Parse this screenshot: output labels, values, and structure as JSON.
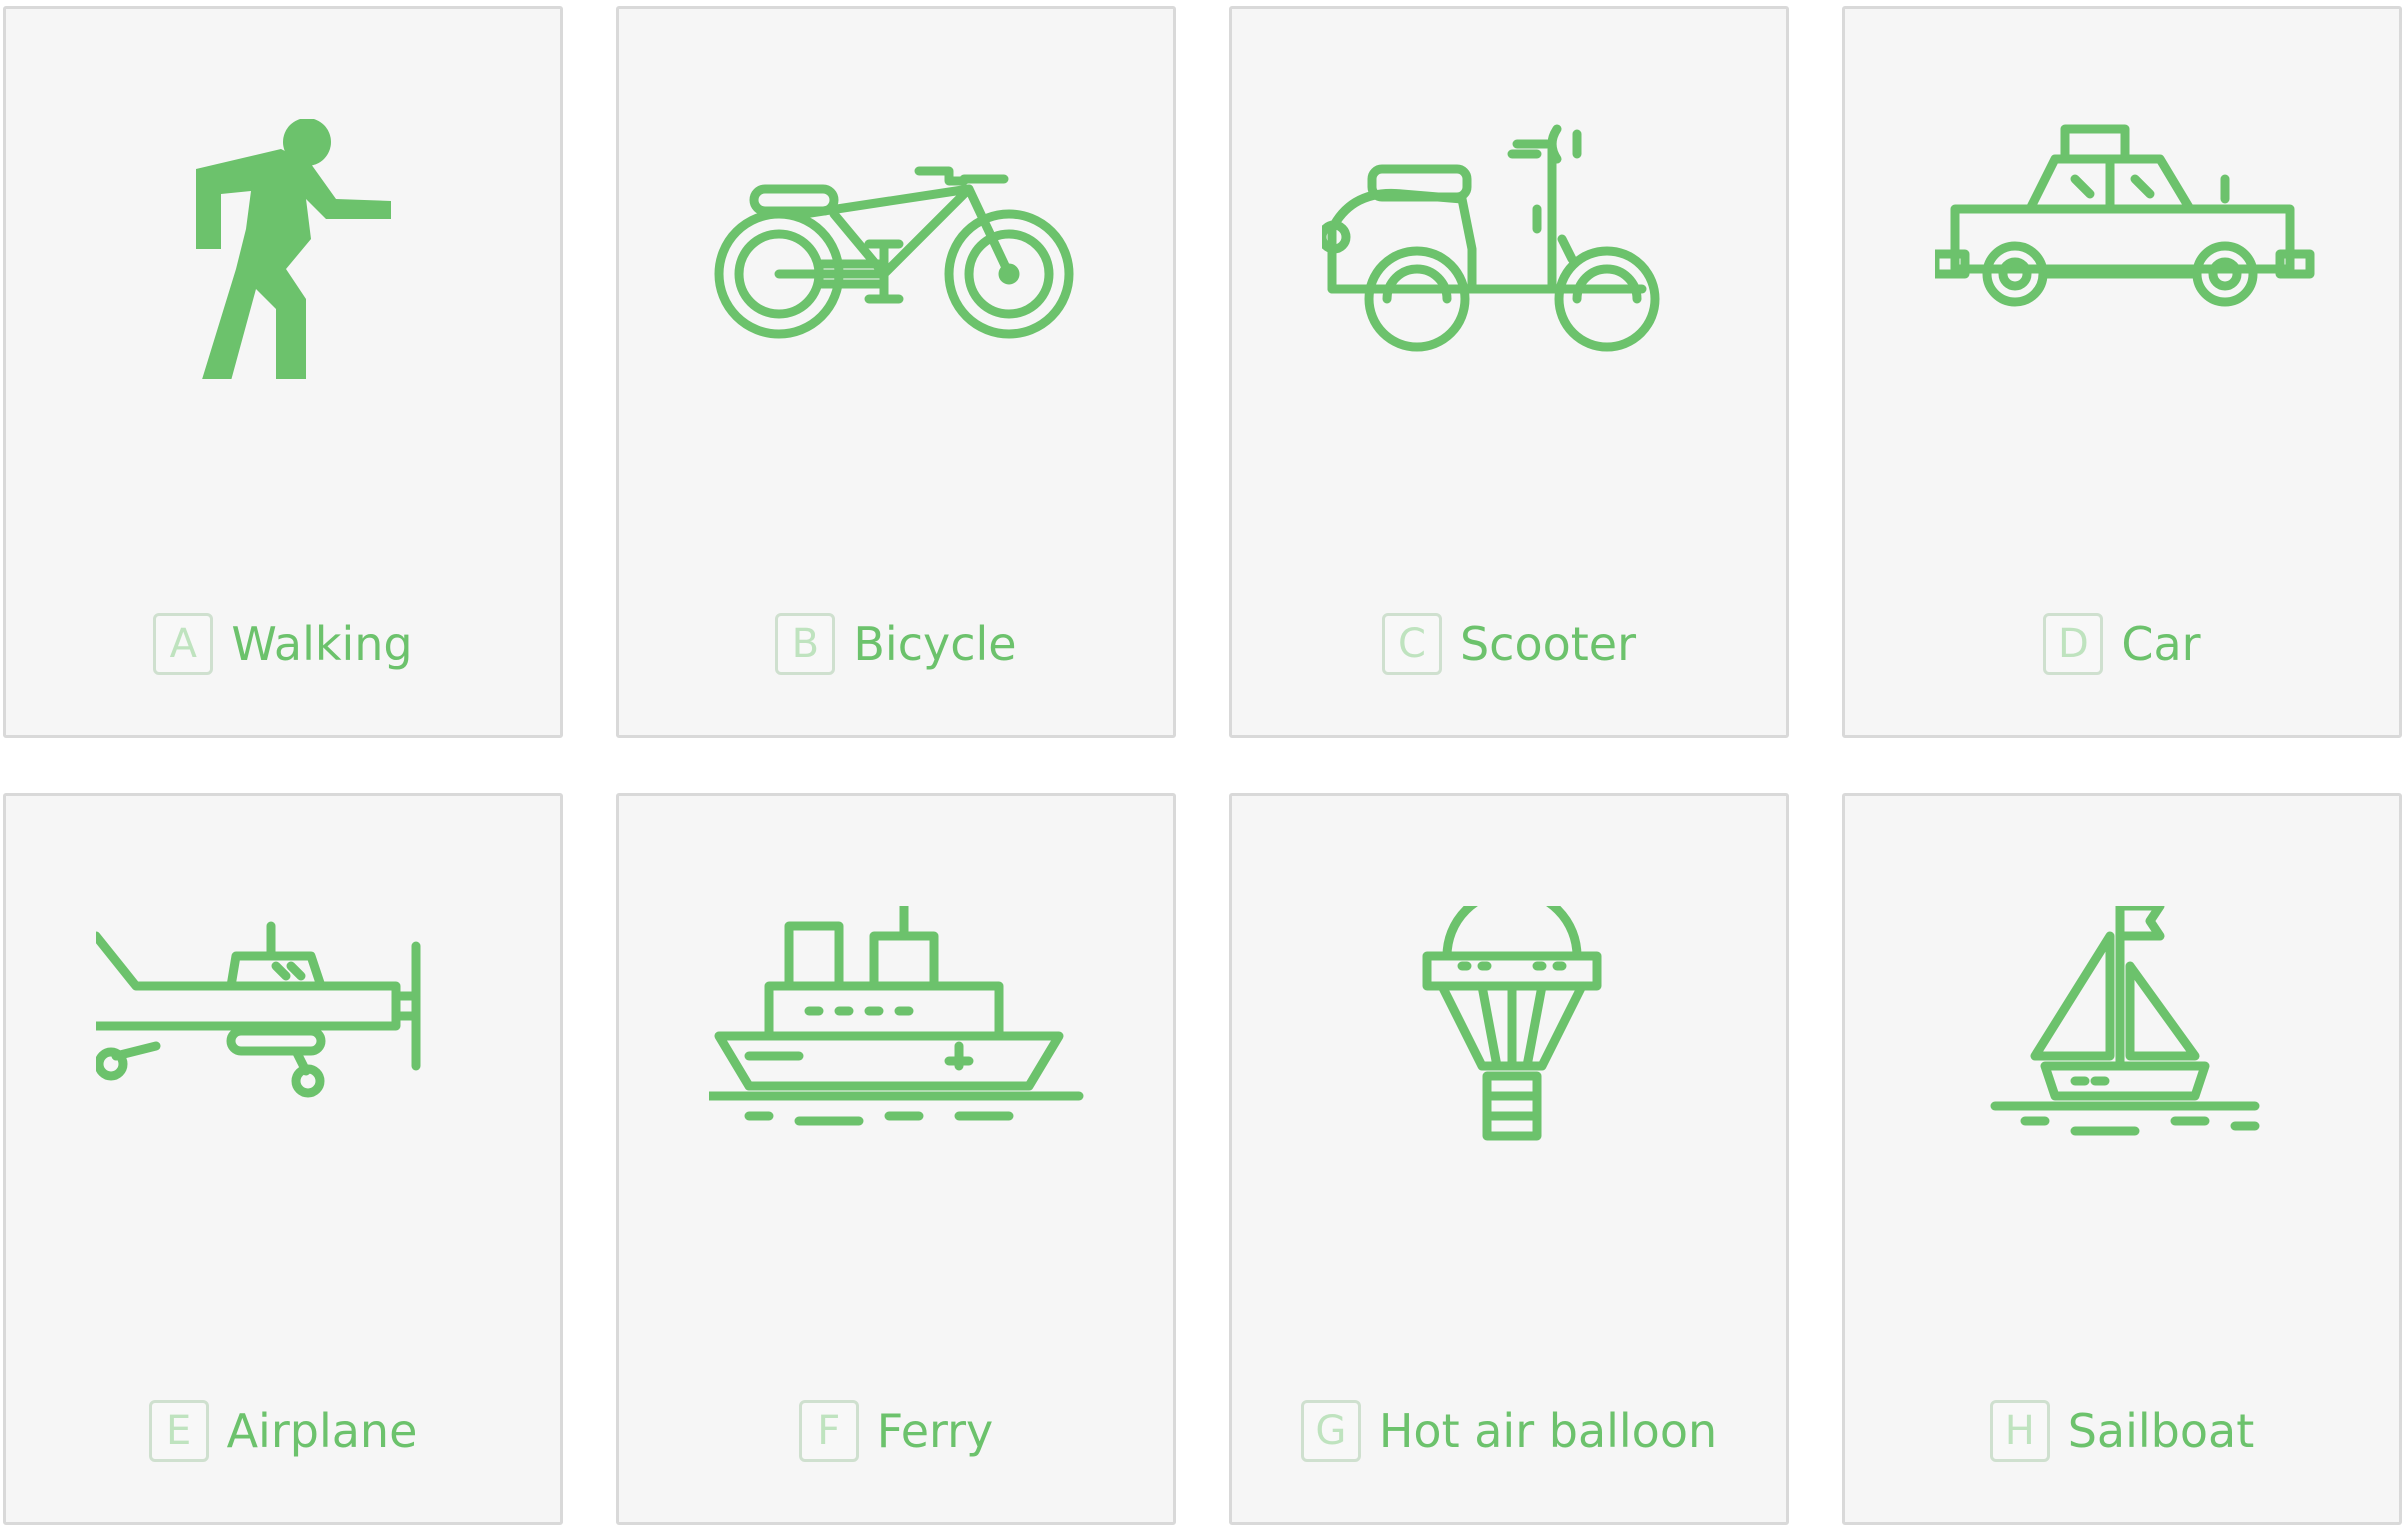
{
  "accent_color": "#6cc26c",
  "key_color": "#bfe3bf",
  "card_background": "#f6f6f6",
  "card_border": "#d9d9d9",
  "options": [
    {
      "key": "A",
      "label": "Walking",
      "icon": "walking-person-icon"
    },
    {
      "key": "B",
      "label": "Bicycle",
      "icon": "bicycle-icon"
    },
    {
      "key": "C",
      "label": "Scooter",
      "icon": "scooter-icon"
    },
    {
      "key": "D",
      "label": "Car",
      "icon": "car-icon"
    },
    {
      "key": "E",
      "label": "Airplane",
      "icon": "airplane-icon"
    },
    {
      "key": "F",
      "label": "Ferry",
      "icon": "ferry-icon"
    },
    {
      "key": "G",
      "label": "Hot air balloon",
      "icon": "hot-air-balloon-icon"
    },
    {
      "key": "H",
      "label": "Sailboat",
      "icon": "sailboat-icon"
    }
  ]
}
